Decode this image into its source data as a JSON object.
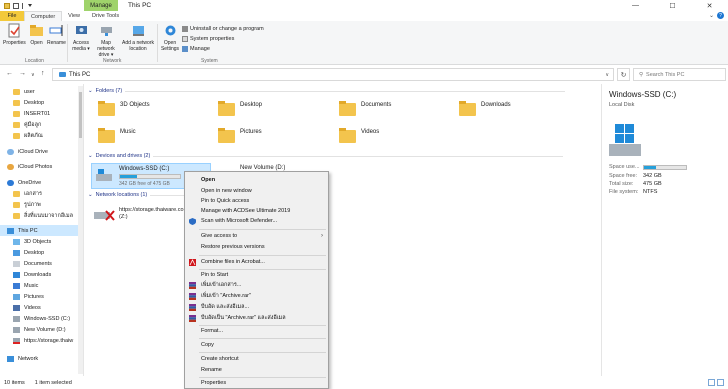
{
  "window": {
    "title": "This PC",
    "context_tab_label": "Manage",
    "controls": {
      "minimize": "—",
      "maximize": "☐",
      "close": "✕"
    }
  },
  "tabs": [
    "File",
    "Computer",
    "View",
    "Drive Tools"
  ],
  "ribbon": {
    "location": {
      "label": "Location",
      "buttons": [
        "Properties",
        "Open",
        "Rename"
      ]
    },
    "network": {
      "label": "Network",
      "buttons": [
        "Access media ▾",
        "Map network drive ▾",
        "Add a network location"
      ]
    },
    "system": {
      "label": "System",
      "open_settings": "Open Settings",
      "commands": [
        "Uninstall or change a program",
        "System properties",
        "Manage"
      ]
    }
  },
  "address": {
    "path": "This PC",
    "search_placeholder": "Search This PC",
    "nav": {
      "back": "←",
      "forward": "→",
      "up_list": "∨",
      "up": "↑",
      "refresh": "↻"
    }
  },
  "navpane": {
    "items": [
      {
        "label": "user",
        "icon": "folder"
      },
      {
        "label": "Desktop",
        "icon": "folder"
      },
      {
        "label": "INSERT01",
        "icon": "folder"
      },
      {
        "label": "คู่มือลูก",
        "icon": "folder"
      },
      {
        "label": "ผลิตภัณ",
        "icon": "folder"
      },
      {
        "label": "iCloud Drive",
        "icon": "cloud"
      },
      {
        "label": "iCloud Photos",
        "icon": "photos"
      },
      {
        "label": "OneDrive",
        "icon": "onedrive"
      },
      {
        "label": "เอกสาร",
        "icon": "folder"
      },
      {
        "label": "รูปภาพ",
        "icon": "folder"
      },
      {
        "label": "สิ่งที่แนบมาจากอีเมล",
        "icon": "folder"
      },
      {
        "label": "This PC",
        "icon": "pc"
      },
      {
        "label": "3D Objects",
        "icon": "folder-3d"
      },
      {
        "label": "Desktop",
        "icon": "folder-desktop"
      },
      {
        "label": "Documents",
        "icon": "folder-docs"
      },
      {
        "label": "Downloads",
        "icon": "folder-down"
      },
      {
        "label": "Music",
        "icon": "music"
      },
      {
        "label": "Pictures",
        "icon": "pictures"
      },
      {
        "label": "Videos",
        "icon": "videos"
      },
      {
        "label": "Windows-SSD (C:)",
        "icon": "drive"
      },
      {
        "label": "New Volume (D:)",
        "icon": "drive"
      },
      {
        "label": "https://storage.thaiw",
        "icon": "netdrive"
      },
      {
        "label": "Network",
        "icon": "network"
      }
    ]
  },
  "content": {
    "folders_header": "Folders (7)",
    "folders": [
      "3D Objects",
      "Desktop",
      "Documents",
      "Downloads",
      "Music",
      "Pictures",
      "Videos"
    ],
    "drives_header": "Devices and drives (2)",
    "drives": [
      {
        "name": "Windows-SSD (C:)",
        "free_text": "342 GB free of 475 GB",
        "used_fraction": 0.28
      },
      {
        "name": "New Volume (D:)"
      }
    ],
    "network_header": "Network locations (1)",
    "network": [
      {
        "line1": "https://storage.thaiware.co",
        "line2": "(Z:)"
      }
    ]
  },
  "details": {
    "title": "Windows-SSD (C:)",
    "subtitle": "Local Disk",
    "space_used_label": "Space use...",
    "used_fraction": 0.28,
    "rows": [
      {
        "k": "Space free:",
        "v": "342 GB"
      },
      {
        "k": "Total size:",
        "v": "475 GB"
      },
      {
        "k": "File system:",
        "v": "NTFS"
      }
    ]
  },
  "status": {
    "count": "10 items",
    "selected": "1 item selected"
  },
  "context_menu": {
    "items": [
      {
        "label": "Open",
        "bold": true
      },
      {
        "label": "Open in new window"
      },
      {
        "label": "Pin to Quick access"
      },
      {
        "label": "Manage with ACDSee Ultimate 2019"
      },
      {
        "label": "Scan with Microsoft Defender...",
        "icon": "defender"
      },
      {
        "label": "Give access to",
        "submenu": true
      },
      {
        "label": "Restore previous versions"
      },
      {
        "label": "Combine files in Acrobat...",
        "icon": "acrobat"
      },
      {
        "label": "Pin to Start"
      },
      {
        "label": "เพิ่มเข้าเอกสาร...",
        "icon": "winrar"
      },
      {
        "label": "เพิ่มเข้า \"Archive.rar\"",
        "icon": "winrar"
      },
      {
        "label": "บีบอัด และส่งอีเมล...",
        "icon": "winrar"
      },
      {
        "label": "บีบอัดเป็น \"Archive.rar\" และส่งอีเมล",
        "icon": "winrar"
      },
      {
        "label": "Format..."
      },
      {
        "label": "Copy"
      },
      {
        "label": "Create shortcut"
      },
      {
        "label": "Rename"
      },
      {
        "label": "Properties"
      }
    ]
  }
}
